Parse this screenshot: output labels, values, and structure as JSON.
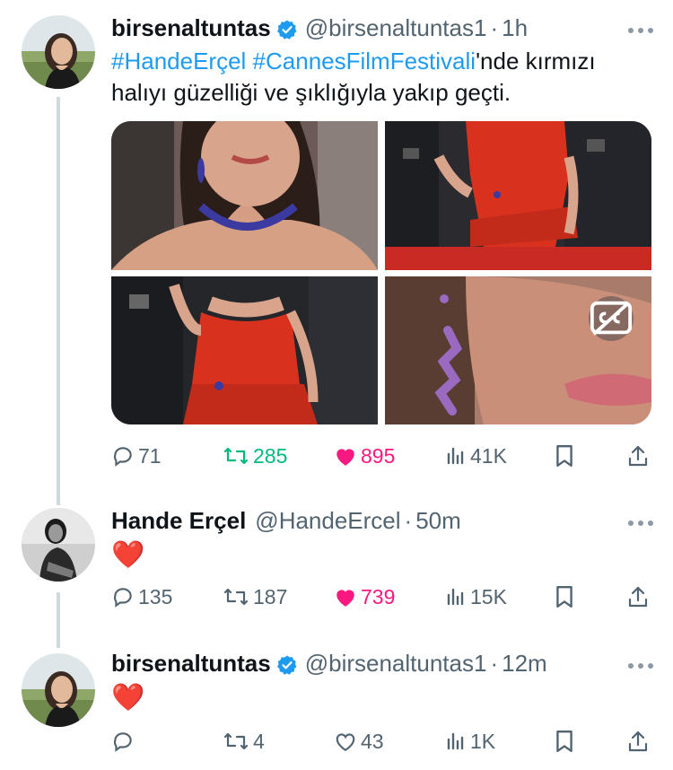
{
  "tweets": [
    {
      "name": "birsenaltuntas",
      "handle": "@birsenaltuntas1",
      "separator": "·",
      "time": "1h",
      "text_tag1": "#HandeErçel",
      "text_tag2": "#CannesFilmFestivali",
      "text_rest": "'nde kırmızı halıyı güzelliği ve şıklığıyla yakıp geçti.",
      "replies": "71",
      "retweets": "285",
      "likes": "895",
      "views": "41K"
    },
    {
      "name": "Hande Erçel",
      "handle": "@HandeErcel",
      "separator": "·",
      "time": "50m",
      "text": "❤️",
      "replies": "135",
      "retweets": "187",
      "likes": "739",
      "views": "15K"
    },
    {
      "name": "birsenaltuntas",
      "handle": "@birsenaltuntas1",
      "separator": "·",
      "time": "12m",
      "text": "❤️",
      "replies": "",
      "retweets": "4",
      "likes": "43",
      "views": "1K"
    }
  ],
  "colors": {
    "accent": "#1d9bf0",
    "retweet": "#00ba7c",
    "like": "#f91880",
    "muted": "#536471",
    "thread_line": "#cfd9de"
  },
  "icons": [
    "verified-badge-icon",
    "more-icon",
    "reply-icon",
    "retweet-icon",
    "like-icon",
    "views-icon",
    "bookmark-icon",
    "share-icon",
    "captions-icon"
  ]
}
